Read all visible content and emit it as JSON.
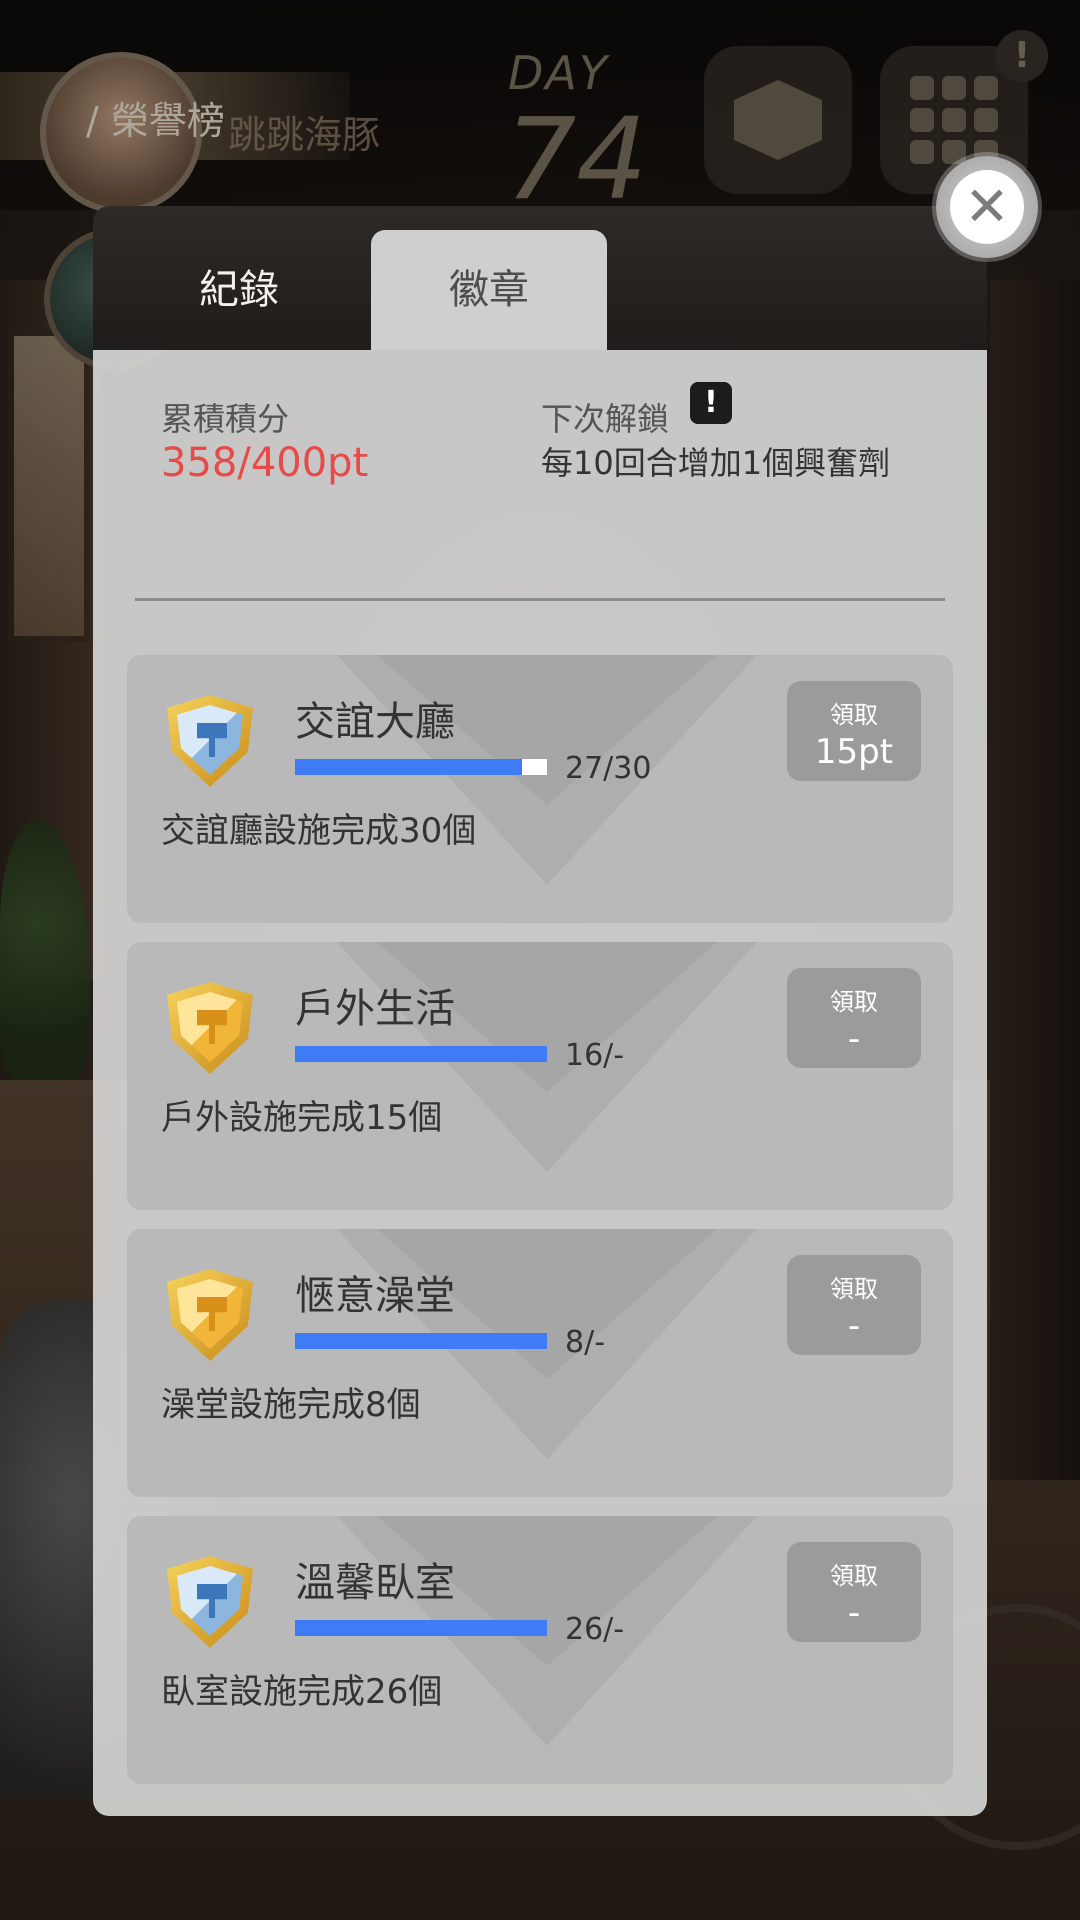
{
  "hud": {
    "honor_title": "/ 榮譽榜",
    "username": "跳跳海豚",
    "day_label": "DAY",
    "day_number": "74",
    "alert_glyph": "!"
  },
  "tabs": [
    {
      "label": "紀錄",
      "selected": false
    },
    {
      "label": "徽章",
      "selected": true
    }
  ],
  "summary": {
    "points_label": "累積積分",
    "points_value": "358/400pt",
    "next_unlock_label": "下次解鎖",
    "next_unlock_text": "每10回合增加1個興奮劑"
  },
  "badges": [
    {
      "title": "交誼大廳",
      "progress_text": "27/30",
      "progress_ratio": 0.9,
      "description": "交誼廳設施完成30個",
      "claim_label": "領取",
      "claim_value": "15pt",
      "icon": "blue-shield-badge-icon"
    },
    {
      "title": "戶外生活",
      "progress_text": "16/-",
      "progress_ratio": 1.0,
      "description": "戶外設施完成15個",
      "claim_label": "領取",
      "claim_value": "-",
      "icon": "gold-shield-badge-icon"
    },
    {
      "title": "愜意澡堂",
      "progress_text": "8/-",
      "progress_ratio": 1.0,
      "description": "澡堂設施完成8個",
      "claim_label": "領取",
      "claim_value": "-",
      "icon": "gold-shield-badge-icon"
    },
    {
      "title": "溫馨臥室",
      "progress_text": "26/-",
      "progress_ratio": 1.0,
      "description": "臥室設施完成26個",
      "claim_label": "領取",
      "claim_value": "-",
      "icon": "blue-shield-badge-icon"
    }
  ],
  "colors": {
    "accent_red": "#e84a4a",
    "progress_blue": "#3e7bf4"
  }
}
